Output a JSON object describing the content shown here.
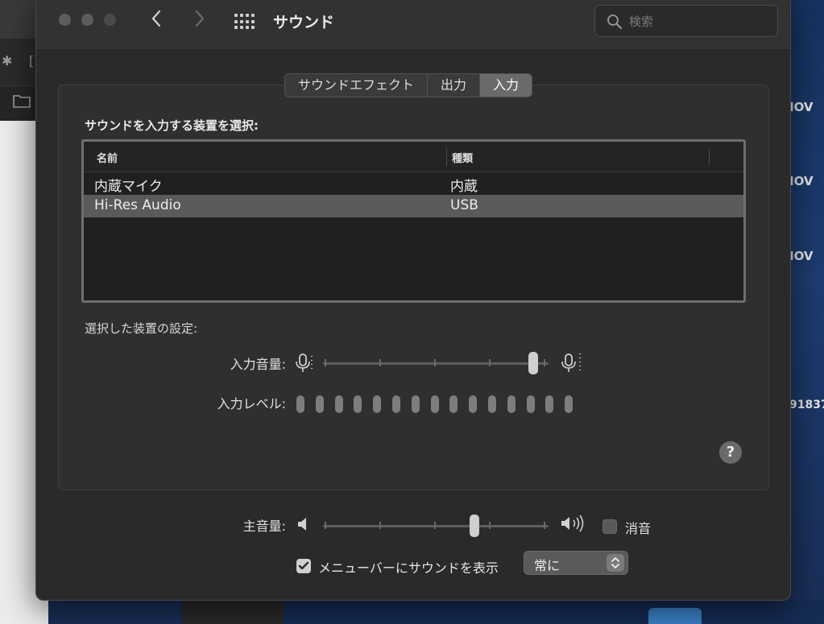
{
  "window": {
    "title": "サウンド",
    "search": {
      "placeholder": "検索"
    }
  },
  "tabs": [
    {
      "label": "サウンドエフェクト",
      "selected": false
    },
    {
      "label": "出力",
      "selected": false
    },
    {
      "label": "入力",
      "selected": true
    }
  ],
  "input_panel": {
    "device_prompt": "サウンドを入力する装置を選択:",
    "table": {
      "columns": [
        "名前",
        "種類"
      ],
      "rows": [
        {
          "name": "内蔵マイク",
          "type": "内蔵",
          "selected": false
        },
        {
          "name": "Hi-Res Audio",
          "type": "USB",
          "selected": true
        }
      ]
    },
    "selected_device_settings": "選択した装置の設定:",
    "input_volume": {
      "label": "入力音量:",
      "level": 0.95
    },
    "input_level": {
      "label": "入力レベル:",
      "bar_count": 15,
      "active_bars": 0
    }
  },
  "footer": {
    "output_volume": {
      "label": "主音量:",
      "level": 0.68
    },
    "mute": {
      "label": "消音",
      "checked": false
    },
    "menubar": {
      "label": "メニューバーにサウンドを表示",
      "checked": true,
      "option": "常に"
    }
  },
  "background": {
    "labels": [
      "IOV",
      "IOV",
      "IOV",
      "91837"
    ]
  },
  "colors": {
    "window_bg": "#2a2a2a",
    "selected_row": "#5a5a5a",
    "selected_tab": "#6a6a6a",
    "desktop": "#1d3c70"
  }
}
